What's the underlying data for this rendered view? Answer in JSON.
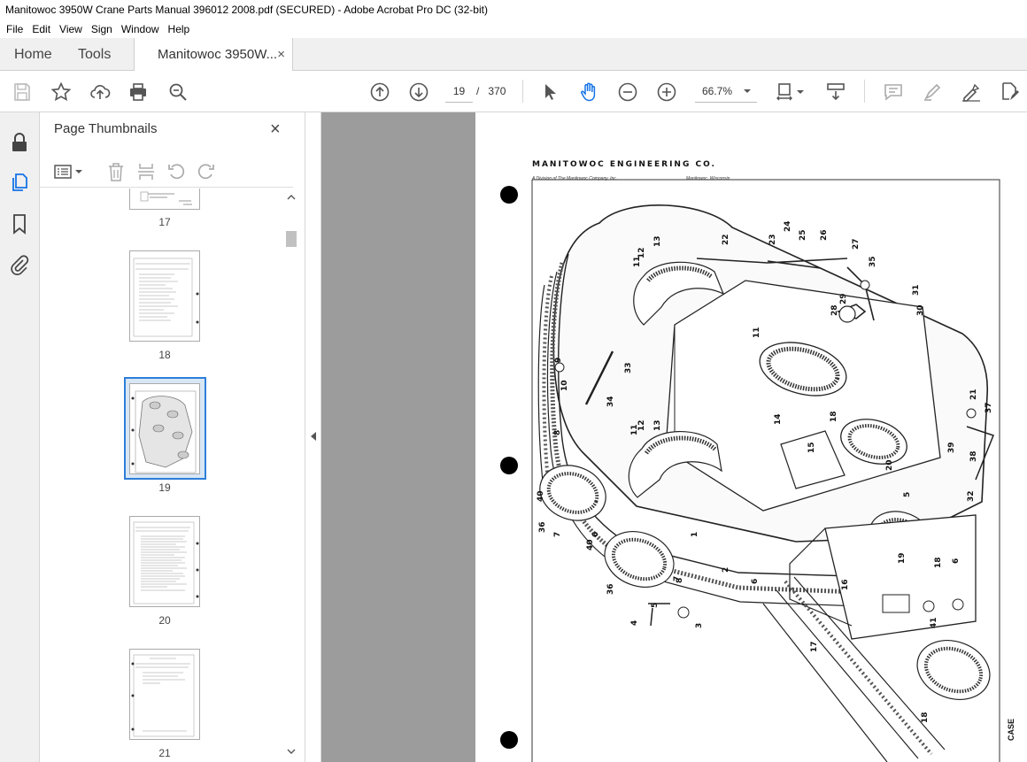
{
  "window": {
    "title": "Manitowoc 3950W Crane Parts Manual 396012 2008.pdf (SECURED) - Adobe Acrobat Pro DC (32-bit)"
  },
  "menu": [
    "File",
    "Edit",
    "View",
    "Sign",
    "Window",
    "Help"
  ],
  "tabs": {
    "home": "Home",
    "tools": "Tools",
    "document": "Manitowoc 3950W...",
    "close": "×"
  },
  "toolbar": {
    "icons": [
      "save-icon",
      "star-icon",
      "share-icon",
      "print-icon",
      "zoom-search-icon",
      "page-up-icon",
      "page-down-icon",
      "select-icon",
      "hand-icon",
      "zoom-out-icon",
      "zoom-in-icon",
      "fit-page-icon",
      "scroll-mode-icon",
      "comment-icon",
      "highlight-icon",
      "sign-icon",
      "edit-icon"
    ],
    "current_page": "19",
    "page_separator": "/",
    "total_pages": "370",
    "zoom": "66.7%"
  },
  "panel": {
    "title": "Page Thumbnails",
    "close": "×",
    "thumbnails": [
      {
        "label": "17"
      },
      {
        "label": "18"
      },
      {
        "label": "19",
        "selected": true
      },
      {
        "label": "20"
      },
      {
        "label": "21"
      }
    ]
  },
  "document": {
    "header": "MANITOWOC ENGINEERING CO.",
    "subheader_left": "A Division of The Manitowoc Company, Inc.",
    "subheader_right": "Manitowoc, Wisconsin",
    "corner_label": "CASE",
    "part_numbers": [
      "1",
      "2",
      "3",
      "4",
      "5",
      "5",
      "6",
      "6",
      "6",
      "7",
      "7",
      "8",
      "8",
      "9",
      "10",
      "11",
      "11",
      "11",
      "12",
      "12",
      "13",
      "13",
      "14",
      "15",
      "16",
      "17",
      "18",
      "18",
      "18",
      "19",
      "20",
      "21",
      "22",
      "23",
      "24",
      "25",
      "26",
      "27",
      "28",
      "29",
      "30",
      "31",
      "32",
      "33",
      "34",
      "35",
      "36",
      "36",
      "37",
      "38",
      "39",
      "40",
      "40",
      "41"
    ]
  }
}
